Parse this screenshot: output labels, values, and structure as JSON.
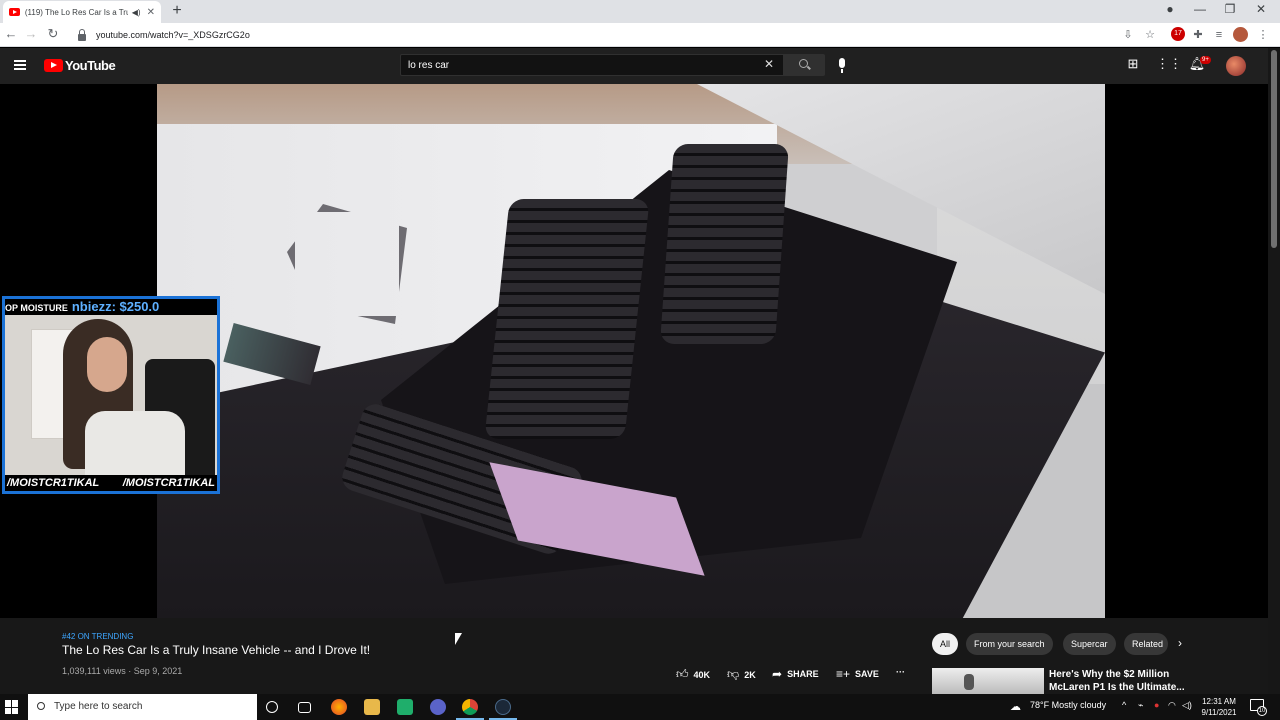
{
  "browser": {
    "tab_title": "(119) The Lo Res Car Is a Tru",
    "url": "youtube.com/watch?v=_XDSGzrCG2o",
    "ext_badge": "17"
  },
  "youtube": {
    "logo": "YouTube",
    "search_value": "lo res car",
    "notifications": "9+",
    "video": {
      "trending": "#42 ON TRENDING",
      "title": "The Lo Res Car Is a Truly Insane Vehicle -- and I Drove It!",
      "meta": "1,039,111 views · Sep 9, 2021",
      "likes": "40K",
      "dislikes": "2K",
      "share": "SHARE",
      "save": "SAVE",
      "more": "···"
    },
    "chips": [
      "All",
      "From your search",
      "Supercar",
      "Related"
    ],
    "recommendation": {
      "title": "Here's Why the $2 Million McLaren P1 Is the Ultimate..."
    }
  },
  "overlay": {
    "banner_tag": "OP MOISTURE",
    "banner_text": "nbiezz: $250.0",
    "handle_left": "/MOISTCR1TIKAL",
    "handle_right": "/MOISTCR1TIKAL"
  },
  "taskbar": {
    "search_placeholder": "Type here to search",
    "weather": "78°F  Mostly cloudy",
    "time": "12:31 AM",
    "date": "9/11/2021",
    "action_center_badge": "10"
  },
  "colors": {
    "youtube_red": "#ff0000",
    "link_blue": "#3ea6ff",
    "webcam_border": "#1b72d6"
  }
}
